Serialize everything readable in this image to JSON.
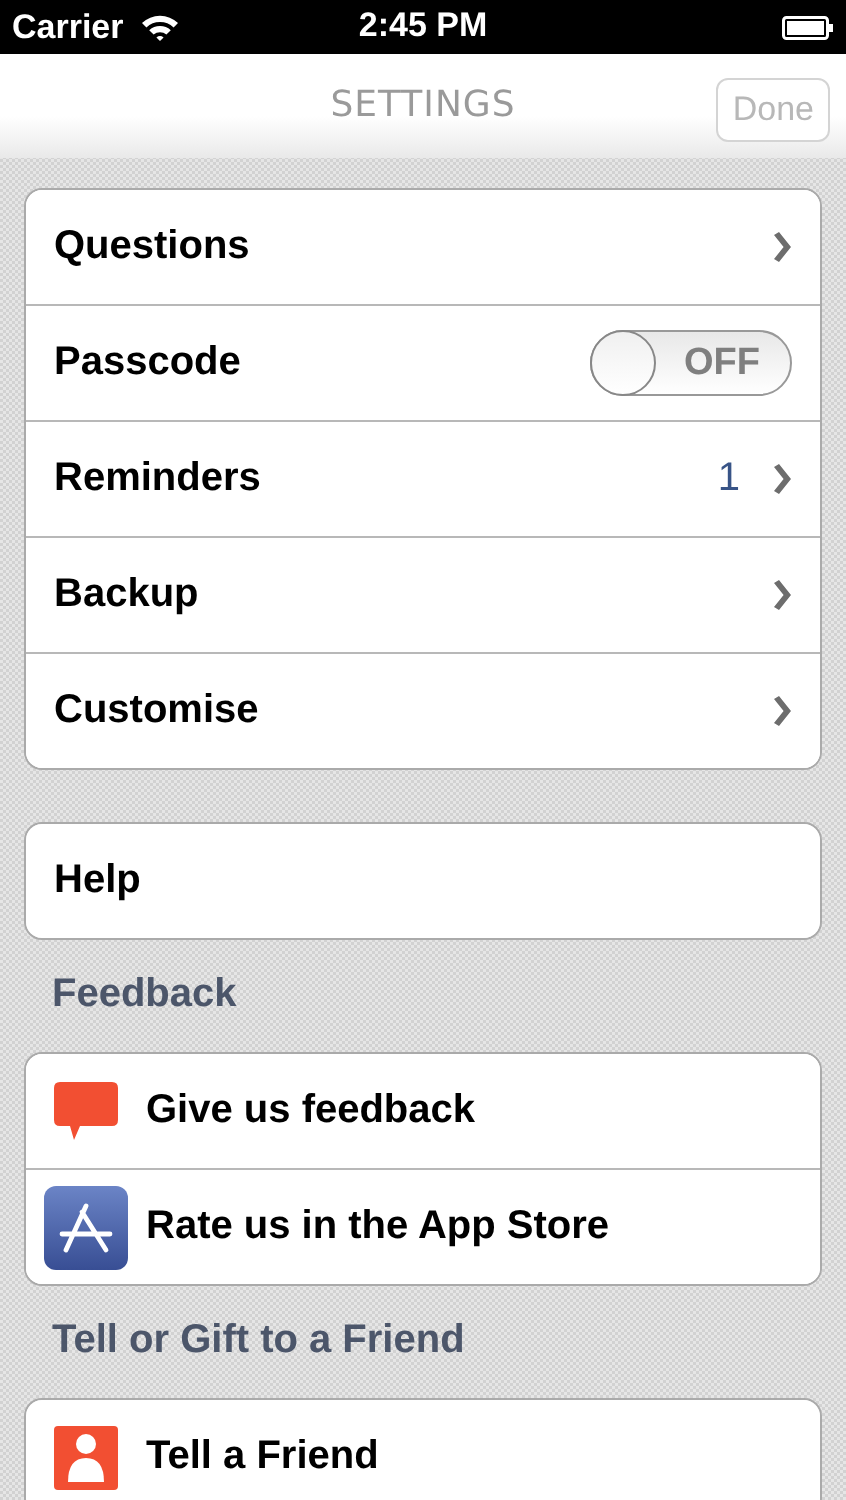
{
  "status_bar": {
    "carrier": "Carrier",
    "time": "2:45 PM"
  },
  "nav": {
    "title": "SETTINGS",
    "done": {
      "label": "Done",
      "disabled": true
    }
  },
  "sections": [
    {
      "rows": [
        {
          "label": "Questions",
          "kind": "disclosure"
        },
        {
          "label": "Passcode",
          "kind": "toggle",
          "on": false,
          "toggle_label": "OFF"
        },
        {
          "label": "Reminders",
          "kind": "disclosure",
          "value": "1"
        },
        {
          "label": "Backup",
          "kind": "disclosure"
        },
        {
          "label": "Customise",
          "kind": "disclosure"
        }
      ]
    },
    {
      "rows": [
        {
          "label": "Help",
          "kind": "plain"
        }
      ]
    },
    {
      "header": "Feedback",
      "rows": [
        {
          "label": "Give us feedback",
          "kind": "icon"
        },
        {
          "label": "Rate us in the App Store",
          "kind": "icon"
        }
      ]
    },
    {
      "header": "Tell or Gift to a Friend",
      "rows": [
        {
          "label": "Tell a Friend",
          "kind": "icon"
        }
      ]
    }
  ]
}
